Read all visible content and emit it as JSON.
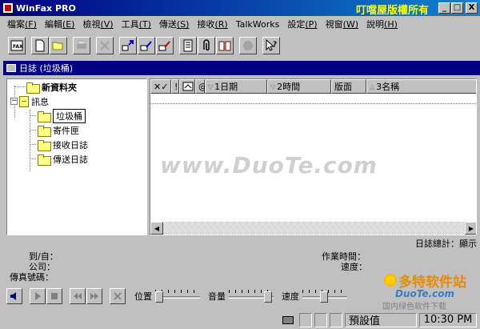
{
  "window": {
    "title": "WinFax PRO",
    "brand_overlay": "叮噹屋版權所有",
    "min_glyph": "_",
    "max_glyph": "□",
    "close_glyph": "X"
  },
  "menu": [
    {
      "label": "檔案",
      "accel": "(F)"
    },
    {
      "label": "編輯",
      "accel": "(E)"
    },
    {
      "label": "檢視",
      "accel": "(V)"
    },
    {
      "label": "工具",
      "accel": "(T)"
    },
    {
      "label": "傳送",
      "accel": "(S)"
    },
    {
      "label": "接收",
      "accel": "(R)"
    },
    {
      "label": "TalkWorks",
      "accel": ""
    },
    {
      "label": "設定",
      "accel": "(P)"
    },
    {
      "label": "視窗",
      "accel": "(W)"
    },
    {
      "label": "說明",
      "accel": "(H)"
    }
  ],
  "log_window": {
    "title": "日誌 (垃圾桶)"
  },
  "tree": {
    "new_folder": "新資料夾",
    "messages": "訊息",
    "trash": "垃圾桶",
    "outbox": "寄件匣",
    "receive_log": "接收日誌",
    "send_log": "傳送日誌"
  },
  "list": {
    "columns": {
      "flags": "✕✓",
      "excl": "!",
      "at": "@",
      "date": "1日期",
      "time": "2時間",
      "pages": "版面",
      "name": "3名稱"
    }
  },
  "log_total": "日誌總計：顯示",
  "detail": {
    "to_from": "到/自：",
    "company": "公司：",
    "fax_number": "傳真號碼：",
    "job_time": "作業時間：",
    "speed": "速度："
  },
  "controls": {
    "position": "位置",
    "volume": "音量",
    "speed": "速度"
  },
  "status": {
    "default": "預設值",
    "clock": "10:30 PM"
  },
  "watermark": {
    "main": "www.DuoTe.com",
    "logo_cn": "多特软件站",
    "logo_en": "DuoTe.com",
    "logo_sub": "国内绿色软件下载"
  }
}
